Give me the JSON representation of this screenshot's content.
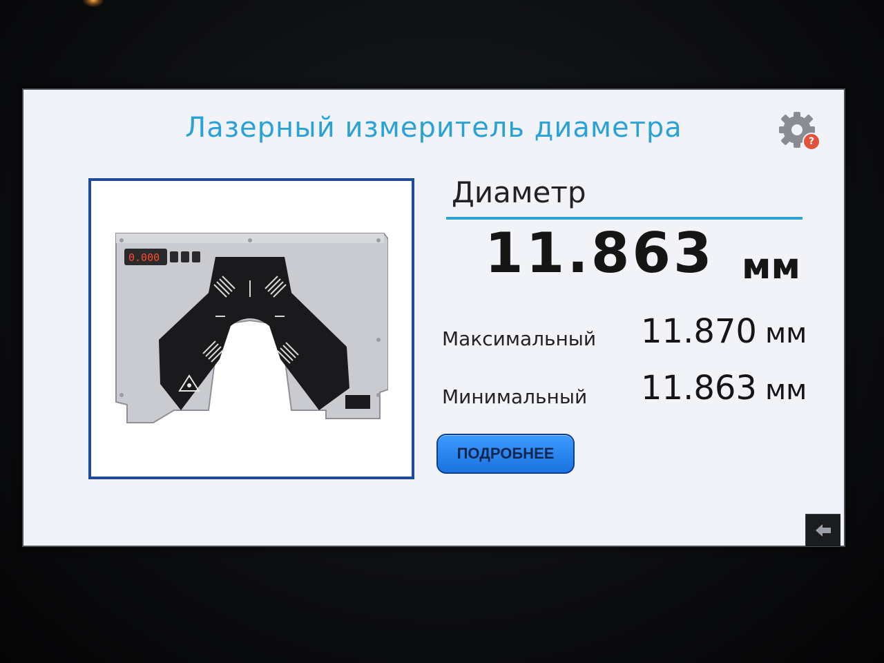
{
  "screen": {
    "title": "Лазерный измеритель диаметра",
    "settings_icon": "gear-icon",
    "help_badge": "?",
    "device_display": "0.000"
  },
  "measurement": {
    "label": "Диаметр",
    "value": "11.863",
    "unit": "мм",
    "max": {
      "label": "Максимальный",
      "value": "11.870",
      "unit": "мм"
    },
    "min": {
      "label": "Минимальный",
      "value": "11.863",
      "unit": "мм"
    }
  },
  "buttons": {
    "details": "ПОДРОБНЕЕ",
    "back_icon": "back-arrow-icon"
  },
  "colors": {
    "accent": "#2aa2d6",
    "frame": "#1f4b9a",
    "button": "#2a86f0",
    "badge": "#e0533a"
  }
}
